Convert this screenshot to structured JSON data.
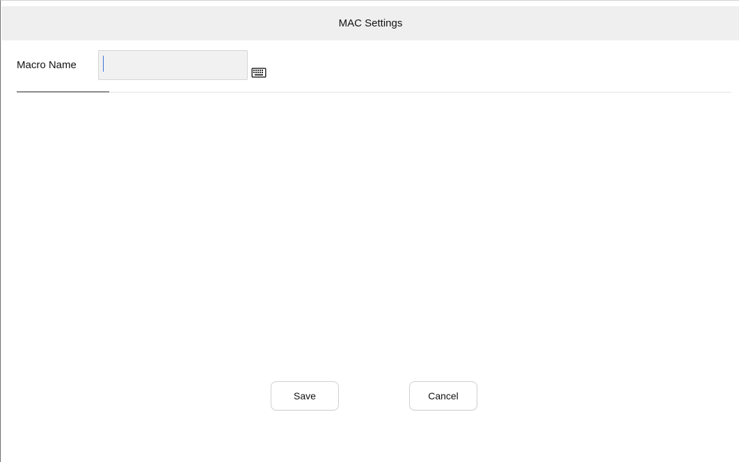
{
  "dialog": {
    "title": "MAC Settings"
  },
  "form": {
    "macro_name_label": "Macro Name",
    "macro_name_value": "",
    "keyboard_icon": "keyboard-icon"
  },
  "actions": {
    "save_label": "Save",
    "cancel_label": "Cancel"
  },
  "colors": {
    "title_bar_bg": "#efefef",
    "input_bg": "#f1f1f1",
    "caret": "#3c6fd6"
  }
}
